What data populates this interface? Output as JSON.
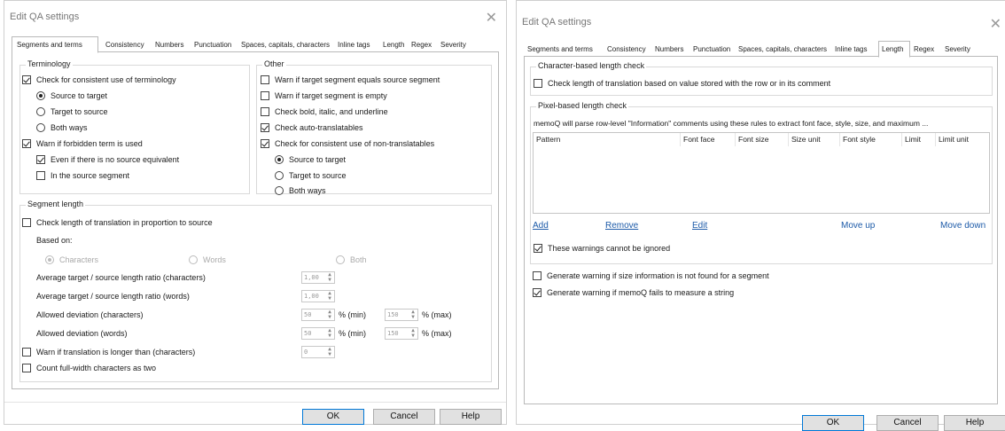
{
  "left_dialog": {
    "title": "Edit QA settings",
    "tabs": [
      "Segments and terms",
      "Consistency",
      "Numbers",
      "Punctuation",
      "Spaces, capitals, characters",
      "Inline tags",
      "Length",
      "Regex",
      "Severity"
    ],
    "active_tab": "Segments and terms",
    "terminology": {
      "label": "Terminology",
      "consistent_terminology": "Check for consistent use of terminology",
      "source_to_target": "Source to target",
      "target_to_source": "Target to source",
      "both_ways": "Both ways",
      "warn_forbidden": "Warn if forbidden term is used",
      "even_no_source": "Even if there is no source equivalent",
      "in_source_segment": "In the source segment"
    },
    "other": {
      "label": "Other",
      "warn_equals_source": "Warn if target segment equals source segment",
      "warn_empty": "Warn if target segment is empty",
      "check_bold": "Check bold, italic, and underline",
      "check_auto": "Check auto-translatables",
      "check_nontrans": "Check for consistent use of non-translatables",
      "source_to_target": "Source to target",
      "target_to_source": "Target to source",
      "both_ways": "Both ways"
    },
    "segment_length": {
      "label": "Segment length",
      "check_length": "Check length of translation in proportion to source",
      "based_on": "Based on:",
      "characters": "Characters",
      "words": "Words",
      "both": "Both",
      "avg_ratio_chars": "Average target / source length ratio (characters)",
      "avg_ratio_chars_value": "1,00",
      "avg_ratio_words": "Average target / source length ratio (words)",
      "avg_ratio_words_value": "1,00",
      "dev_chars": "Allowed deviation (characters)",
      "dev_chars_min": "50",
      "dev_chars_max": "150",
      "dev_words": "Allowed deviation (words)",
      "dev_words_min": "50",
      "dev_words_max": "150",
      "min_label": "% (min)",
      "max_label": "% (max)",
      "warn_longer": "Warn if translation is longer than (characters)",
      "warn_longer_value": "0",
      "fullwidth": "Count full-width characters as two"
    },
    "buttons": {
      "ok": "OK",
      "cancel": "Cancel",
      "help": "Help"
    }
  },
  "right_dialog": {
    "title": "Edit QA settings",
    "tabs": [
      "Segments and terms",
      "Consistency",
      "Numbers",
      "Punctuation",
      "Spaces, capitals, characters",
      "Inline tags",
      "Length",
      "Regex",
      "Severity"
    ],
    "active_tab": "Length",
    "char_length": {
      "label": "Character-based length check",
      "check_stored": "Check length of translation based on value stored with the row or in its comment"
    },
    "pixel_length": {
      "label": "Pixel-based length check",
      "info": "memoQ will parse row-level \"Information\" comments using these rules to extract font face, style, size, and maximum ...",
      "columns": [
        "Pattern",
        "Font face",
        "Font size",
        "Size unit",
        "Font style",
        "Limit",
        "Limit unit"
      ],
      "add": "Add",
      "remove": "Remove",
      "edit": "Edit",
      "move_up": "Move up",
      "move_down": "Move down",
      "cannot_ignore": "These warnings cannot be ignored",
      "warn_no_size": "Generate warning if size information is not found for a segment",
      "warn_measure": "Generate warning if memoQ fails to measure a string"
    },
    "buttons": {
      "ok": "OK",
      "cancel": "Cancel",
      "help": "Help"
    }
  }
}
